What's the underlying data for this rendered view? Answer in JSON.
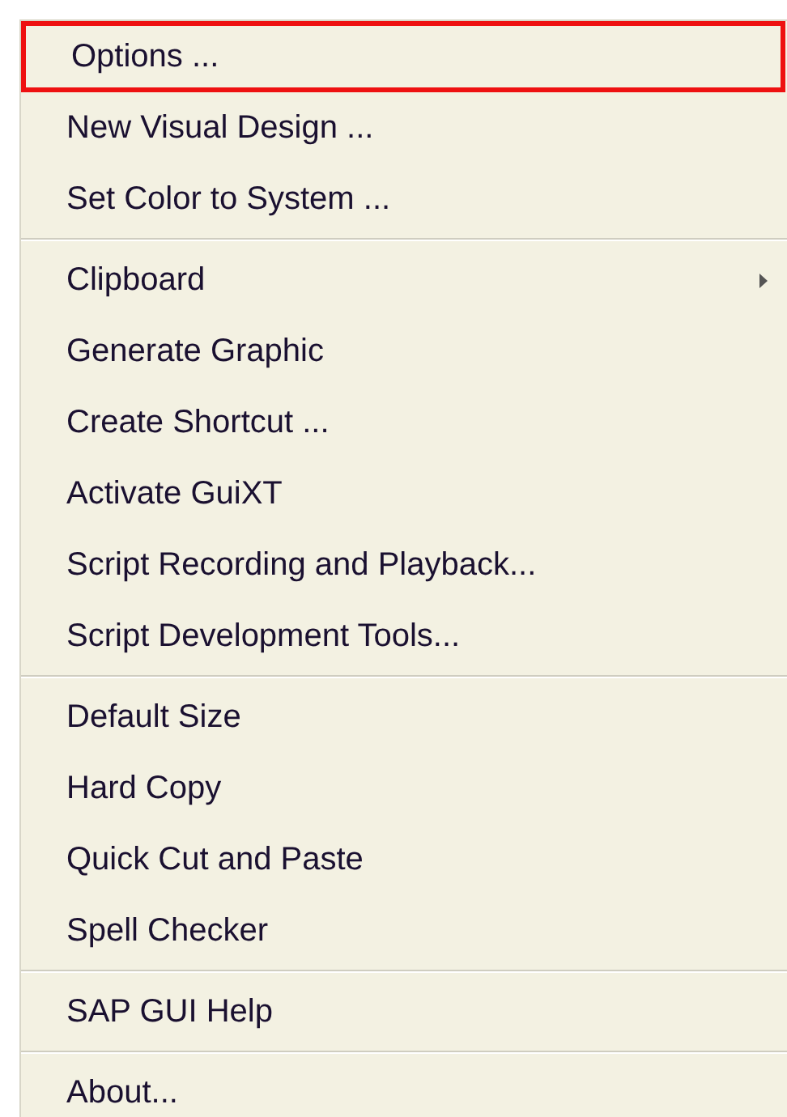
{
  "menu": {
    "groups": [
      [
        {
          "label": "Options ...",
          "selected": true,
          "submenu": false
        },
        {
          "label": "New Visual Design ...",
          "selected": false,
          "submenu": false
        },
        {
          "label": "Set Color to System ...",
          "selected": false,
          "submenu": false
        }
      ],
      [
        {
          "label": "Clipboard",
          "selected": false,
          "submenu": true
        },
        {
          "label": "Generate Graphic",
          "selected": false,
          "submenu": false
        },
        {
          "label": "Create Shortcut ...",
          "selected": false,
          "submenu": false
        },
        {
          "label": "Activate GuiXT",
          "selected": false,
          "submenu": false
        },
        {
          "label": "Script Recording and Playback...",
          "selected": false,
          "submenu": false
        },
        {
          "label": "Script Development Tools...",
          "selected": false,
          "submenu": false
        }
      ],
      [
        {
          "label": "Default Size",
          "selected": false,
          "submenu": false
        },
        {
          "label": "Hard Copy",
          "selected": false,
          "submenu": false
        },
        {
          "label": "Quick Cut and Paste",
          "selected": false,
          "submenu": false
        },
        {
          "label": "Spell Checker",
          "selected": false,
          "submenu": false
        }
      ],
      [
        {
          "label": "SAP GUI Help",
          "selected": false,
          "submenu": false
        }
      ],
      [
        {
          "label": "About...",
          "selected": false,
          "submenu": false
        }
      ]
    ]
  }
}
